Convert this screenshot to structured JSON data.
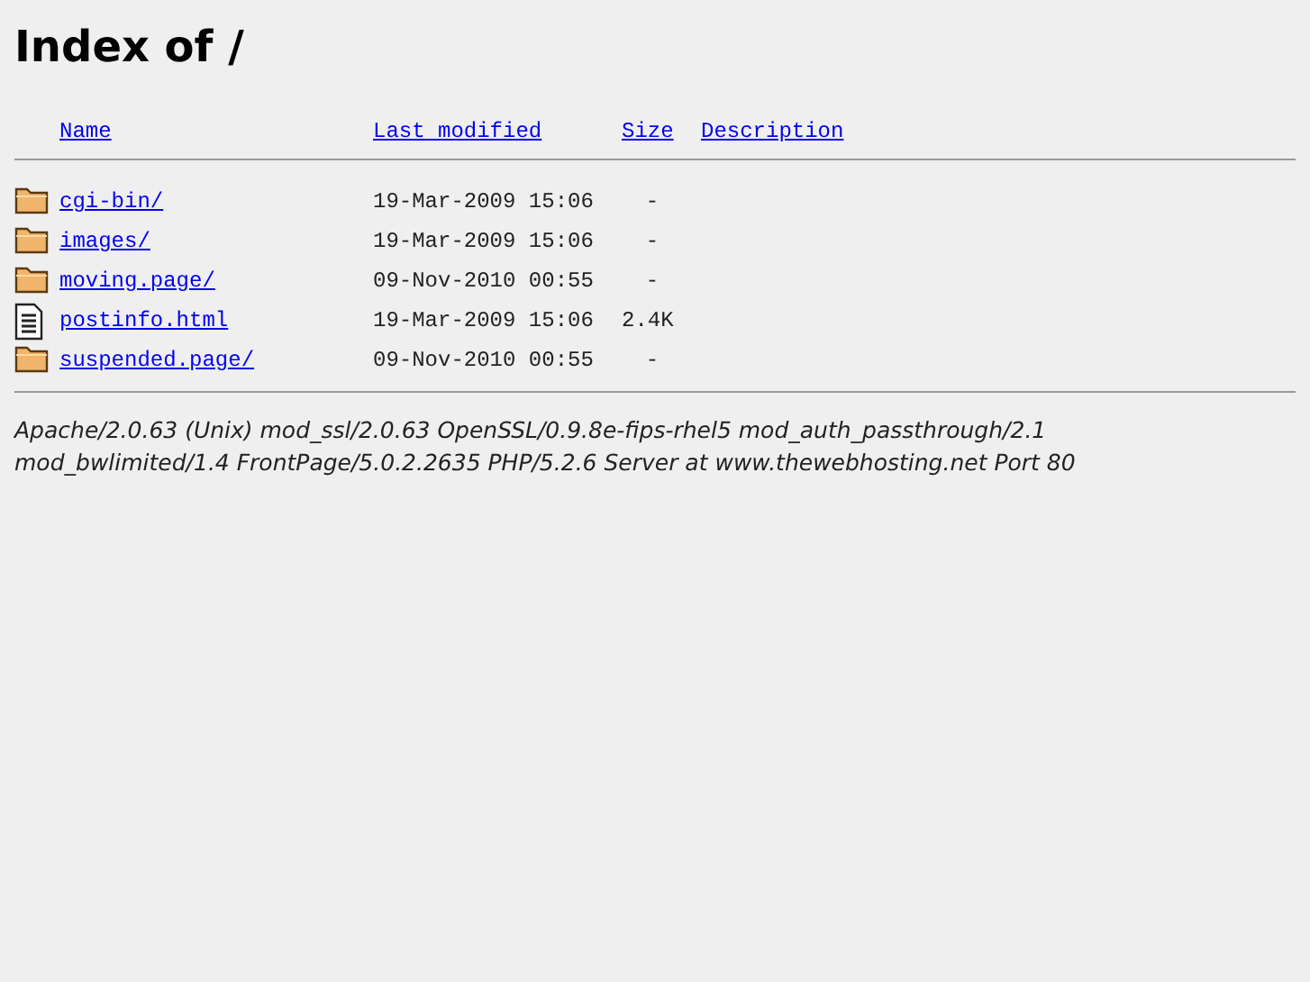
{
  "title": "Index of /",
  "columns": [
    "Name",
    "Last modified",
    "Size",
    "Description"
  ],
  "rows": [
    {
      "kind": "folder",
      "name": "cgi-bin/",
      "modified": "19-Mar-2009 15:06",
      "size": "-"
    },
    {
      "kind": "folder",
      "name": "images/",
      "modified": "19-Mar-2009 15:06",
      "size": "-"
    },
    {
      "kind": "folder",
      "name": "moving.page/",
      "modified": "09-Nov-2010 00:55",
      "size": "-"
    },
    {
      "kind": "file",
      "name": "postinfo.html",
      "modified": "19-Mar-2009 15:06",
      "size": "2.4K"
    },
    {
      "kind": "folder",
      "name": "suspended.page/",
      "modified": "09-Nov-2010 00:55",
      "size": "-"
    }
  ],
  "address": "Apache/2.0.63 (Unix) mod_ssl/2.0.63 OpenSSL/0.9.8e-fips-rhel5 mod_auth_passthrough/2.1 mod_bwlimited/1.4 FrontPage/5.0.2.2635 PHP/5.2.6 Server at www.thewebhosting.net Port 80"
}
